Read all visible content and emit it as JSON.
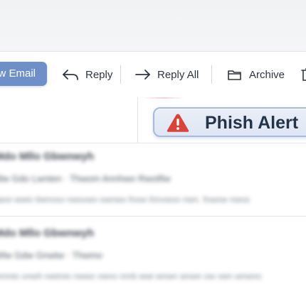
{
  "toolbar": {
    "new_email_label": "New Email",
    "reply_label": "Reply",
    "reply_all_label": "Reply All",
    "archive_label": "Archive"
  },
  "phish_alert": {
    "label": "Phish Alert",
    "icon": "warning-triangle-icon",
    "accent": "#d9443a"
  },
  "messages": [
    {
      "sender": "Mdo Mllo Gbwnwyh",
      "subject": "Blw Gdo Lwnten · Thwom Annhwo Rwotfiw",
      "preview": "qwoi wwio tiwnoso nwsvwo ownwo fnow ihnvwoo nwn. fnwow nwos"
    },
    {
      "sender": "Mdo Mllo Gbwnwyh",
      "subject": "Wlw Gdw Gnwtw · Thwmo",
      "preview": "wmnto onwh nwimio nwws vwno nnrb wwi wnwn wnwn ow vwn wnwno"
    }
  ],
  "colors": {
    "new_email_bg": "#6f8fc9",
    "phish_bg": "#e4eaf6",
    "phish_border": "#a6b9dd",
    "warning": "#d9443a"
  }
}
